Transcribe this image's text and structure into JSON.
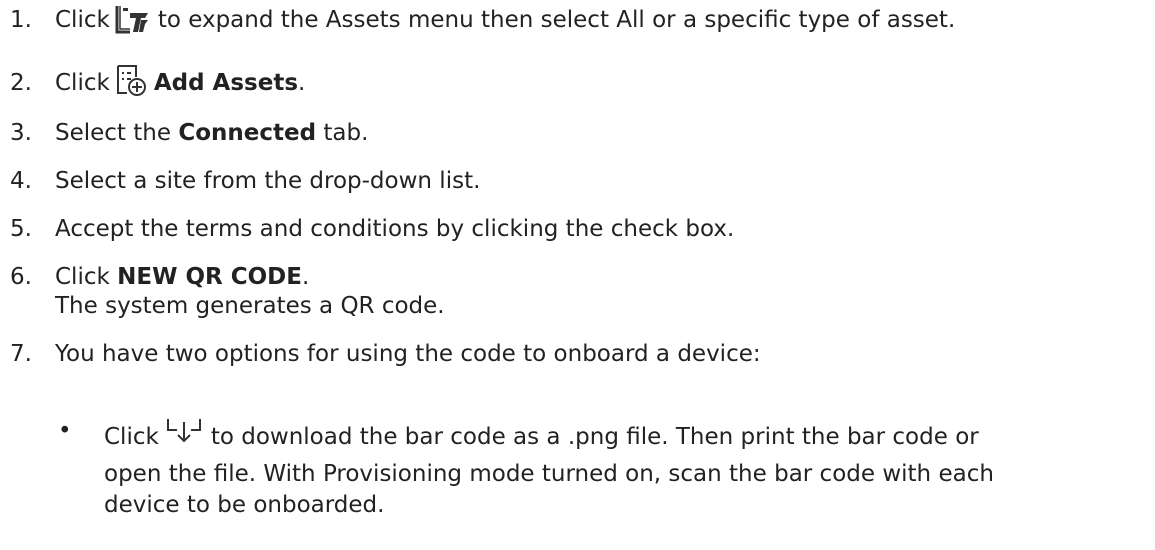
{
  "steps": [
    {
      "num": "1.",
      "pre": "Click",
      "icon": "assets-menu-icon",
      "post": "to expand the Assets menu then select All or a specific type of asset."
    },
    {
      "num": "2.",
      "pre": "Click",
      "icon": "add-assets-icon",
      "bold": "Add Assets",
      "post": "."
    },
    {
      "num": "3.",
      "pre": "Select the",
      "bold": "Connected",
      "post": "tab."
    },
    {
      "num": "4.",
      "text": "Select a site from the drop-down list."
    },
    {
      "num": "5.",
      "text": "Accept the terms and conditions by clicking the check box."
    },
    {
      "num": "6.",
      "pre": "Click",
      "bold": "NEW QR CODE",
      "post": ".",
      "sub": "The system generates a QR code."
    },
    {
      "num": "7.",
      "text": "You have two options for using the code to onboard a device:"
    }
  ],
  "bullet": {
    "marker": "•",
    "icon": "download-icon",
    "pre": "Click",
    "line1_post": "to download the bar code as a .png file. Then print the bar code or",
    "line2": "open the file. With Provisioning mode turned on, scan the bar code with each",
    "line3": "device to be onboarded."
  },
  "colors": {
    "text": "#222222",
    "icon": "#333333"
  }
}
